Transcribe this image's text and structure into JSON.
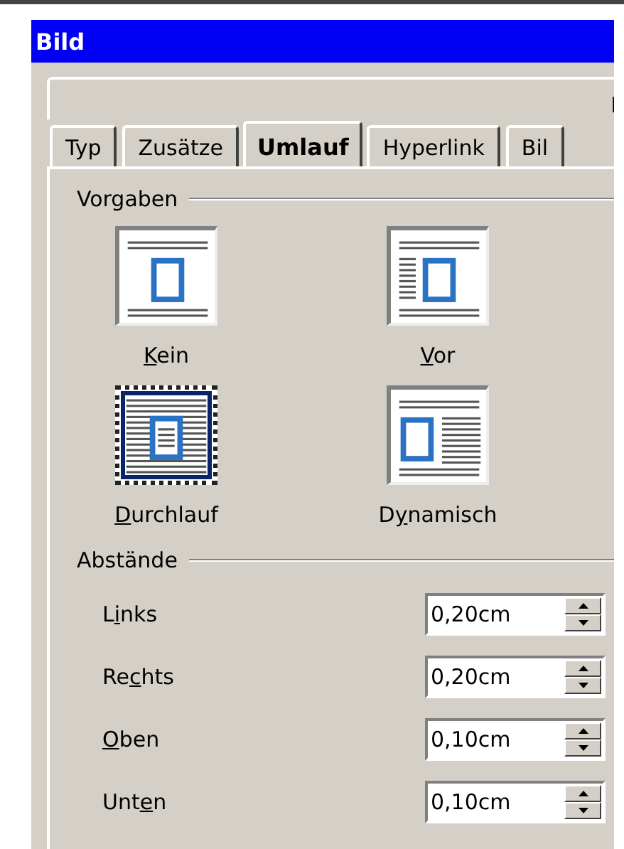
{
  "window": {
    "title": "Bild"
  },
  "upper_tabs": [
    {
      "label": "I"
    }
  ],
  "tabs": [
    {
      "label": "Typ",
      "selected": false
    },
    {
      "label": "Zusätze",
      "selected": false
    },
    {
      "label": "Umlauf",
      "selected": true
    },
    {
      "label": "Hyperlink",
      "selected": false
    },
    {
      "label": "Bil",
      "selected": false
    }
  ],
  "presets": {
    "title": "Vorgaben",
    "items": [
      {
        "kind": "none",
        "access_key": "K",
        "label_rest": "ein",
        "selected": false
      },
      {
        "kind": "before",
        "access_key": "V",
        "label_rest": "or",
        "selected": false
      },
      {
        "kind": "through",
        "access_key": "D",
        "label_rest": "urchlauf",
        "selected": true
      },
      {
        "kind": "dynamic",
        "label_start": "D",
        "access_key": "y",
        "label_rest": "namisch",
        "selected": false
      }
    ]
  },
  "spacing": {
    "title": "Abstände",
    "rows": [
      {
        "label_start": "L",
        "access_key": "i",
        "label_rest": "nks",
        "value": "0,20cm"
      },
      {
        "label_start": "Re",
        "access_key": "c",
        "label_rest": "hts",
        "value": "0,20cm"
      },
      {
        "access_key": "O",
        "label_rest": "ben",
        "value": "0,10cm"
      },
      {
        "label_start": "Unt",
        "access_key": "e",
        "label_rest": "n",
        "value": "0,10cm"
      }
    ]
  }
}
